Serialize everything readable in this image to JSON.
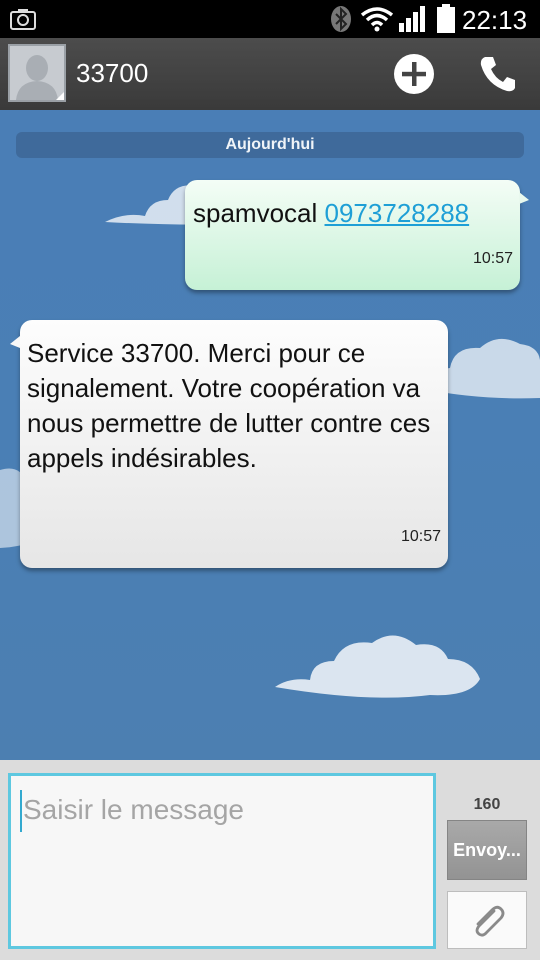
{
  "status_bar": {
    "time": "22:13",
    "icons": [
      "camera-icon",
      "bluetooth-icon",
      "wifi-icon",
      "signal-icon",
      "battery-icon"
    ]
  },
  "header": {
    "contact_name": "33700",
    "icons": [
      "avatar-icon",
      "add-icon",
      "call-icon"
    ]
  },
  "conversation": {
    "date_separator": "Aujourd'hui",
    "messages": [
      {
        "direction": "outgoing",
        "text": "spamvocal",
        "link": "0973728288",
        "time": "10:57"
      },
      {
        "direction": "incoming",
        "text": "Service 33700. Merci pour ce signalement. Votre coopération va nous permettre de lutter contre ces appels indésirables.",
        "time": "10:57"
      }
    ]
  },
  "composer": {
    "placeholder": "Saisir le message",
    "value": "",
    "char_count": "160",
    "send_label": "Envoy...",
    "icons": [
      "paperclip-icon"
    ]
  },
  "colors": {
    "background_sky": "#4a7eb6",
    "outgoing_bubble": "#c6f1d6",
    "incoming_bubble": "#e6e6e6",
    "link": "#1e9fd6",
    "input_border": "#5ec8e0"
  }
}
